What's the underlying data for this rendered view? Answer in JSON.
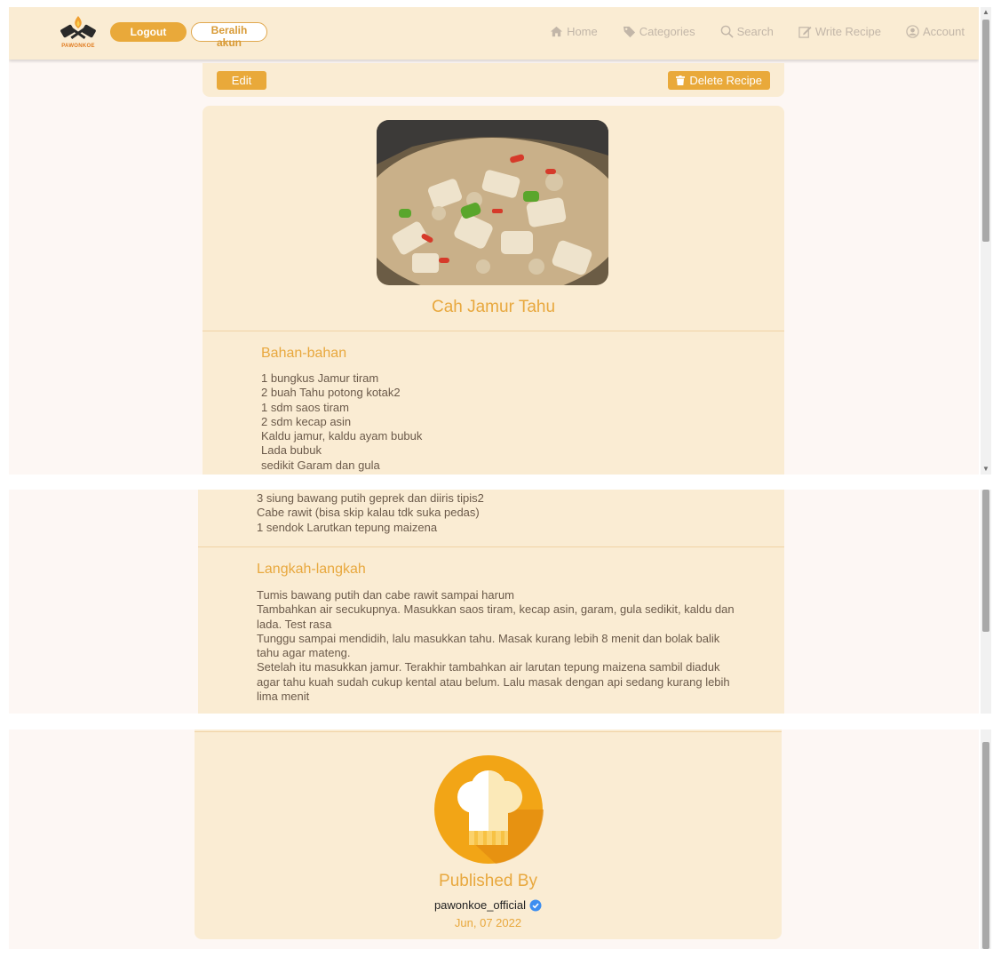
{
  "header": {
    "logo_text": "PAWONKOE",
    "logout_label": "Logout",
    "switch_account_label": "Beralih akun",
    "nav": [
      {
        "label": "Home",
        "icon": "home-icon"
      },
      {
        "label": "Categories",
        "icon": "tag-icon"
      },
      {
        "label": "Search",
        "icon": "search-icon"
      },
      {
        "label": "Write Recipe",
        "icon": "edit-icon"
      },
      {
        "label": "Account",
        "icon": "user-circle-icon"
      }
    ]
  },
  "actions": {
    "edit_label": "Edit",
    "delete_label": "Delete Recipe"
  },
  "recipe": {
    "title": "Cah Jamur Tahu",
    "ingredients_title": "Bahan-bahan",
    "ingredients": [
      "1 bungkus Jamur tiram",
      "2 buah Tahu potong kotak2",
      "1 sdm saos tiram",
      "2 sdm kecap asin",
      "Kaldu jamur, kaldu ayam bubuk",
      "Lada bubuk",
      "sedikit Garam dan gula",
      "3 siung bawang putih geprek dan diiris tipis2",
      "Cabe rawit (bisa skip kalau tdk suka pedas)",
      "1 sendok Larutkan tepung maizena"
    ],
    "steps_title": "Langkah-langkah",
    "steps": [
      "Tumis bawang putih dan cabe rawit sampai harum",
      "Tambahkan air secukupnya. Masukkan saos tiram, kecap asin, garam, gula sedikit, kaldu dan lada. Test rasa",
      "Tunggu sampai mendidih, lalu masukkan tahu. Masak kurang lebih 8 menit dan bolak balik tahu agar mateng.",
      "Setelah itu masukkan jamur. Terakhir tambahkan air larutan tepung maizena sambil diaduk agar tahu kuah sudah cukup kental atau belum. Lalu masak dengan api sedang kurang lebih lima menit"
    ]
  },
  "publisher": {
    "label": "Published By",
    "username": "pawonkoe_official",
    "date": "Jun, 07 2022"
  },
  "colors": {
    "accent": "#e8a83e",
    "header_bg": "#faecd3",
    "page_bg": "#fdf7f4"
  }
}
